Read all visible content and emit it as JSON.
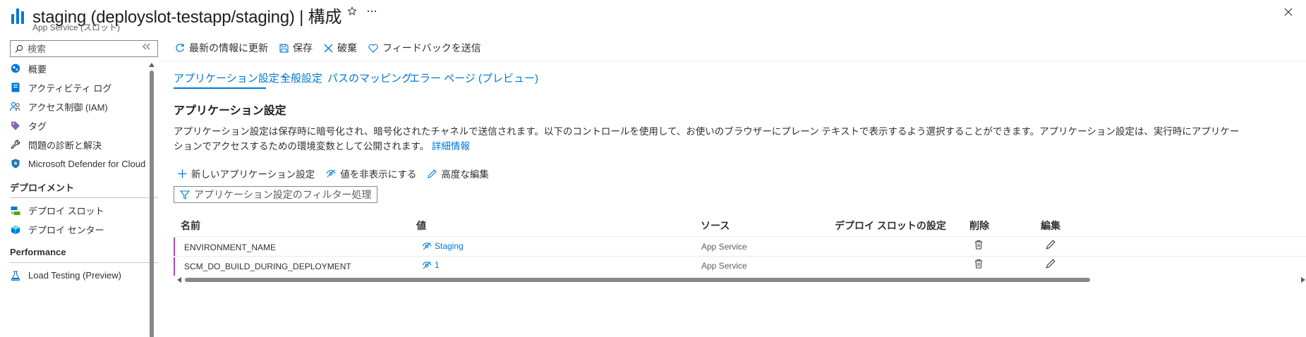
{
  "header": {
    "title": "staging (deployslot-testapp/staging) | 構成",
    "subtitle": "App Service (スロット)",
    "favorite_icon": "star-icon",
    "more_icon": "ellipsis-icon",
    "close_icon": "close-icon"
  },
  "sidebar": {
    "search_placeholder": "検索",
    "collapse_icon": "double-chevron-left-icon",
    "items": [
      {
        "label": "概要",
        "icon": "overview-icon"
      },
      {
        "label": "アクティビティ ログ",
        "icon": "activity-log-icon"
      },
      {
        "label": "アクセス制御 (IAM)",
        "icon": "iam-icon"
      },
      {
        "label": "タグ",
        "icon": "tag-icon"
      },
      {
        "label": "問題の診断と解決",
        "icon": "wrench-icon"
      },
      {
        "label": "Microsoft Defender for Cloud",
        "icon": "shield-icon"
      }
    ],
    "section_deploy": "デプロイメント",
    "deploy_items": [
      {
        "label": "デプロイ スロット",
        "icon": "deployment-slots-icon"
      },
      {
        "label": "デプロイ センター",
        "icon": "deployment-center-icon"
      }
    ],
    "section_performance": "Performance",
    "performance_items": [
      {
        "label": "Load Testing (Preview)",
        "icon": "load-testing-icon"
      }
    ]
  },
  "toolbar": {
    "refresh_label": "最新の情報に更新",
    "save_label": "保存",
    "discard_label": "破棄",
    "feedback_label": "フィードバックを送信"
  },
  "tabs": [
    {
      "label": "アプリケーション設定",
      "active": true,
      "modified_marker": "*"
    },
    {
      "label": "全般設定"
    },
    {
      "label": "パスのマッピング"
    },
    {
      "label": "エラー ページ (プレビュー)"
    }
  ],
  "main": {
    "section_title": "アプリケーション設定",
    "description_line1": "アプリケーション設定は保存時に暗号化され、暗号化されたチャネルで送信されます。以下のコントロールを使用して、お使いのブラウザーにプレーン テキストで表示するよう選択することができます。アプリケーション設定は、実行時にアプリケー",
    "description_line2": "ションでアクセスするための環境変数として公開されます。",
    "learn_more": "詳細情報",
    "actions": {
      "new_label": "新しいアプリケーション設定",
      "hide_values_label": "値を非表示にする",
      "advanced_edit_label": "高度な編集"
    },
    "filter_placeholder": "アプリケーション設定のフィルター処理",
    "table": {
      "columns": [
        "名前",
        "値",
        "ソース",
        "デプロイ スロットの設定",
        "削除",
        "編集"
      ],
      "rows": [
        {
          "name": "ENVIRONMENT_NAME",
          "value": "Staging",
          "source": "App Service"
        },
        {
          "name": "SCM_DO_BUILD_DURING_DEPLOYMENT",
          "value": "1",
          "source": "App Service"
        }
      ]
    }
  },
  "colors": {
    "accent": "#0078d4",
    "modified_marker": "#b146c2",
    "text": "#323130"
  }
}
